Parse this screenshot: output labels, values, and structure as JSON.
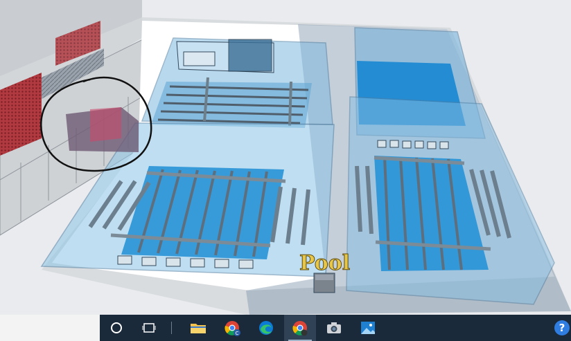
{
  "scene": {
    "sign_text": "Pool",
    "colors": {
      "floor": "#ffffff",
      "glass": "#7fb9e0",
      "water": "#1f8fd6",
      "lane": "#6c7f8e",
      "sign": "#e8c64a",
      "wall": "#9aa3ad",
      "highlight": "#c84a6a"
    }
  },
  "taskbar": {
    "help_label": "?",
    "buttons": [
      {
        "name": "cortana-search",
        "icon": "circle-icon"
      },
      {
        "name": "task-view",
        "icon": "task-view-icon"
      },
      {
        "name": "file-explorer",
        "icon": "folder-icon"
      },
      {
        "name": "chrome-profile",
        "icon": "chrome-icon",
        "badge": "C"
      },
      {
        "name": "edge",
        "icon": "edge-icon"
      },
      {
        "name": "chrome",
        "icon": "chrome-icon"
      },
      {
        "name": "camera",
        "icon": "camera-icon"
      },
      {
        "name": "photos",
        "icon": "photos-icon"
      }
    ]
  }
}
